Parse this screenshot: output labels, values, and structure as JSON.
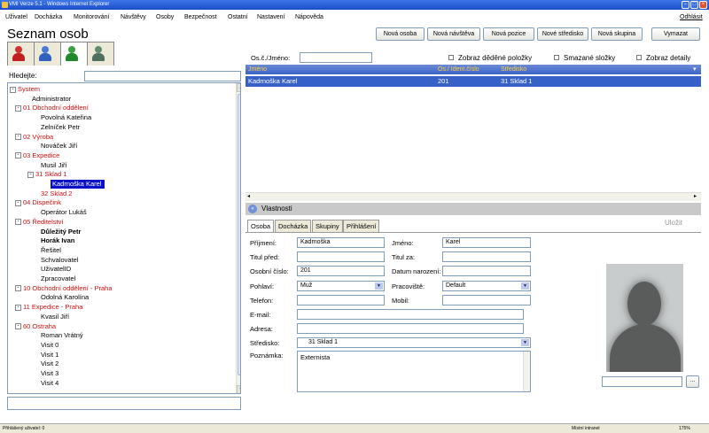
{
  "window": {
    "title": "VMI Verze 5.1 - Windows Internet Explorer"
  },
  "menu": {
    "items": [
      "Uživatel",
      "Docházka",
      "Monitorování",
      "Návštěvy",
      "Osoby",
      "Bezpečnost",
      "Ostatní",
      "Nastavení",
      "Nápověda"
    ],
    "logout": "Odhlásit"
  },
  "page": {
    "title": "Seznam osob"
  },
  "toolbar": {
    "new_person": "Nová osoba",
    "new_visit": "Nová návštěva",
    "new_position": "Nová pozice",
    "new_center": "Nové středisko",
    "new_group": "Nová skupina",
    "delete": "Vymazat"
  },
  "search": {
    "label": "Hledejte:",
    "value": ""
  },
  "filter": {
    "label": "Os.č./Jméno:",
    "value": ""
  },
  "options": {
    "inherited": "Zobraz děděné položky",
    "deleted": "Smazané složky",
    "details": "Zobraz detaily"
  },
  "tree": [
    {
      "text": "System",
      "style": "red",
      "toggle": "-"
    },
    {
      "text": "Administrator",
      "style": ""
    },
    {
      "text": "01 Obchodní oddělení",
      "style": "red",
      "toggle": "-"
    },
    {
      "text": "Povolná Kateřina",
      "style": ""
    },
    {
      "text": "Zelníček Petr",
      "style": ""
    },
    {
      "text": "02 Výroba",
      "style": "red",
      "toggle": "-"
    },
    {
      "text": "Nováček Jiří",
      "style": ""
    },
    {
      "text": "03 Expedice",
      "style": "red",
      "toggle": "-"
    },
    {
      "text": "Musil Jiří",
      "style": ""
    },
    {
      "text": "31 Sklad 1",
      "style": "red",
      "toggle": "-"
    },
    {
      "text": "Kadrnoška Karel",
      "style": "sel"
    },
    {
      "text": "32 Sklad 2",
      "style": "red"
    },
    {
      "text": "04 Dispečink",
      "style": "red",
      "toggle": "-"
    },
    {
      "text": "Operátor Lukáš",
      "style": ""
    },
    {
      "text": "05 Ředitelství",
      "style": "red",
      "toggle": "-"
    },
    {
      "text": "Důležitý Petr",
      "style": "bold"
    },
    {
      "text": "Horák Ivan",
      "style": "bold"
    },
    {
      "text": "Řešitel",
      "style": ""
    },
    {
      "text": "Schvalovatel",
      "style": ""
    },
    {
      "text": "UživatelID",
      "style": ""
    },
    {
      "text": "Zpracovatel",
      "style": ""
    },
    {
      "text": "10 Obchodní oddělení - Praha",
      "style": "red",
      "toggle": "-"
    },
    {
      "text": "Odolná Karolína",
      "style": ""
    },
    {
      "text": "11 Expedice - Praha",
      "style": "red",
      "toggle": "-"
    },
    {
      "text": "Kvasil Jiří",
      "style": ""
    },
    {
      "text": "60 Ostraha",
      "style": "red",
      "toggle": "-"
    },
    {
      "text": "Roman Vrátný",
      "style": ""
    },
    {
      "text": "Visit 0",
      "style": ""
    },
    {
      "text": "Visit 1",
      "style": ""
    },
    {
      "text": "Visit 2",
      "style": ""
    },
    {
      "text": "Visit 3",
      "style": ""
    },
    {
      "text": "Visit 4",
      "style": ""
    }
  ],
  "grid": {
    "columns": [
      "Jméno",
      "Os./ Ident.číslo",
      "Středisko"
    ],
    "rows": [
      [
        "Kadrnoška Karel",
        "201",
        "31 Sklad 1"
      ]
    ]
  },
  "panel": {
    "title": "Vlastnosti",
    "save": "Uložit"
  },
  "tabs": [
    "Osoba",
    "Docházka",
    "Skupiny",
    "Přihlášení"
  ],
  "form": {
    "surname": {
      "label": "Příjmení:",
      "value": "Kadrnoška"
    },
    "firstname": {
      "label": "Jméno:",
      "value": "Karel"
    },
    "title_before": {
      "label": "Titul před:",
      "value": ""
    },
    "title_after": {
      "label": "Titul za:",
      "value": ""
    },
    "personal_number": {
      "label": "Osobní číslo:",
      "value": "201"
    },
    "birth_date": {
      "label": "Datum narození:",
      "value": ""
    },
    "gender": {
      "label": "Pohlaví:",
      "value": "Muž"
    },
    "workplace": {
      "label": "Pracoviště:",
      "value": "Default"
    },
    "phone": {
      "label": "Telefon:",
      "value": ""
    },
    "mobile": {
      "label": "Mobil:",
      "value": ""
    },
    "email": {
      "label": "E-mail:",
      "value": ""
    },
    "address": {
      "label": "Adresa:",
      "value": ""
    },
    "center": {
      "label": "Středisko:",
      "value": "31 Sklad 1"
    },
    "note": {
      "label": "Poznámka:",
      "value": "Externista"
    }
  },
  "photo": {
    "path_value": "",
    "browse": "..."
  },
  "status": {
    "left": "Přihlášený uživatel: 0",
    "zone": "Místní intranet",
    "zoom": "175%"
  },
  "icons": [
    "window-app-icon",
    "users-red-icon",
    "users-blue-icon",
    "users-green-icon",
    "users-gray-icon",
    "properties-toggle-icon",
    "profile-silhouette"
  ]
}
